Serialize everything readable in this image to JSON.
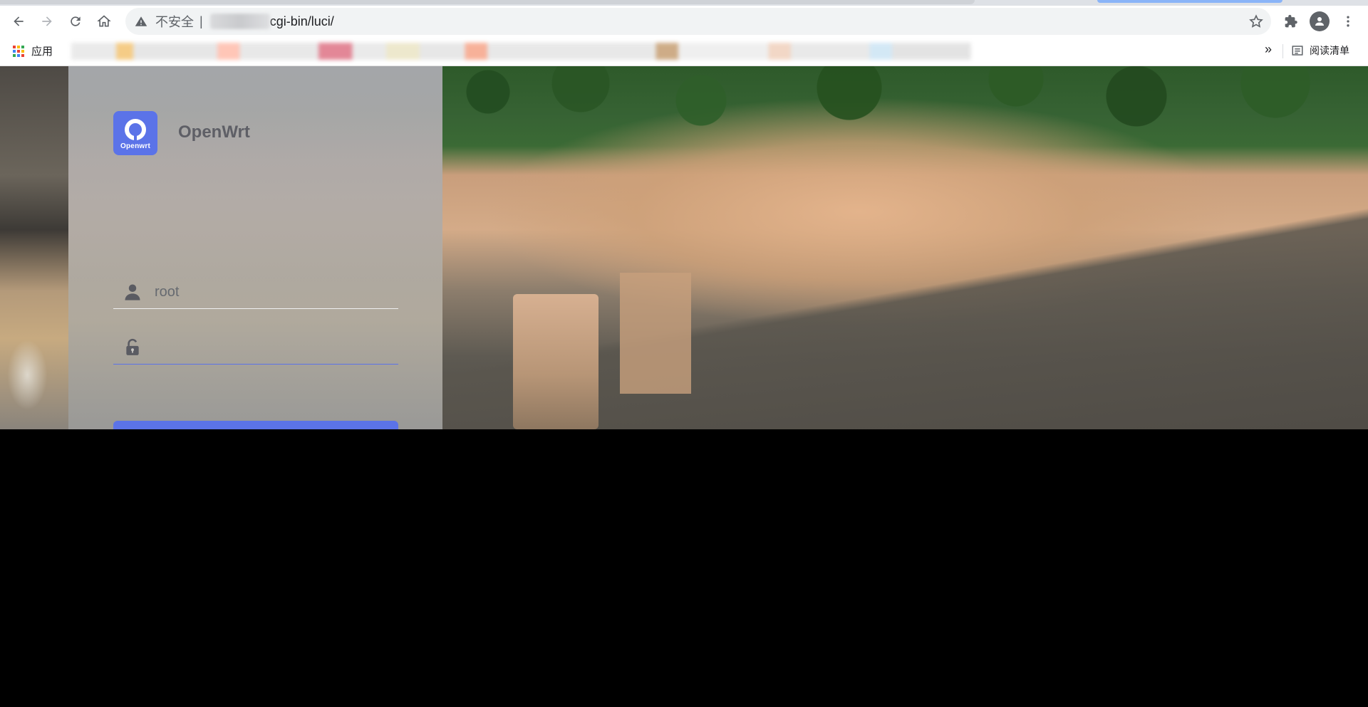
{
  "browser": {
    "security_label": "不安全",
    "separator": "|",
    "url_path": "cgi-bin/luci/",
    "bookmarks_bar": {
      "apps_label": "应用",
      "overflow_label": "»",
      "reading_list_label": "阅读清单"
    },
    "icons": {
      "back": "arrow-left-icon",
      "forward": "arrow-right-icon",
      "reload": "reload-icon",
      "home": "home-icon",
      "warning": "warning-triangle-icon",
      "bookmark_star": "star-icon",
      "extensions": "puzzle-icon",
      "profile": "avatar-icon",
      "menu": "kebab-menu-icon",
      "reading_list": "reading-list-icon"
    }
  },
  "login": {
    "logo_text": "Openwrt",
    "brand": "OpenWrt",
    "username_value": "root",
    "password_value": "",
    "colors": {
      "accent": "#5b73e8",
      "brand_text": "#5e5f66"
    }
  }
}
